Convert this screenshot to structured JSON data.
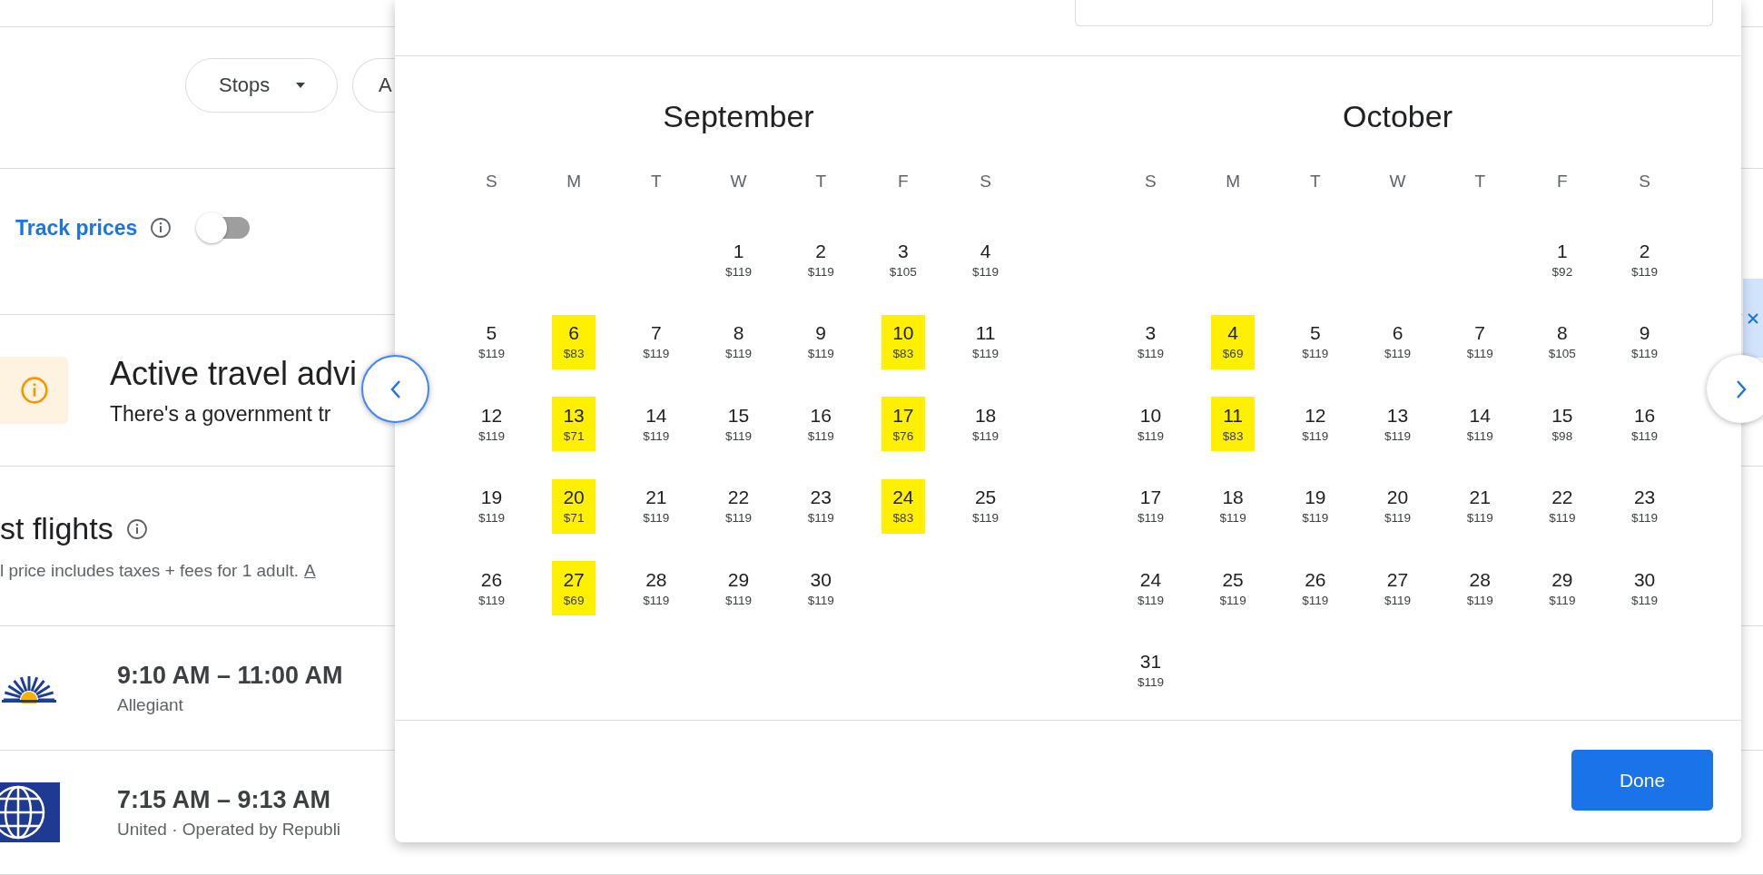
{
  "filters": [
    {
      "label": "Stops",
      "dropdown": true
    },
    {
      "label": "A"
    }
  ],
  "track_prices": {
    "label": "Track prices",
    "on": false
  },
  "advisory": {
    "title": "Active travel advi",
    "text": "There's a government tr"
  },
  "flights_section": {
    "title": "st flights",
    "note": "l price includes taxes + fees for 1 adult.",
    "link": "A"
  },
  "flights": [
    {
      "kind": "sun",
      "times": "9:10 AM – 11:00 AM",
      "airline": "Allegiant"
    },
    {
      "kind": "globe",
      "times": "7:15 AM – 9:13 AM",
      "airline": "United · Operated by Republi"
    }
  ],
  "calendar": {
    "months": [
      {
        "name": "September",
        "weekdays": [
          "S",
          "M",
          "T",
          "W",
          "T",
          "F",
          "S"
        ],
        "weeks": [
          [
            {
              "kind": "blank"
            },
            {
              "kind": "blank"
            },
            {
              "kind": "blank"
            },
            {
              "day": "1",
              "price": "$119",
              "highlighted": false
            },
            {
              "day": "2",
              "price": "$119",
              "highlighted": false
            },
            {
              "day": "3",
              "price": "$105",
              "highlighted": false
            },
            {
              "day": "4",
              "price": "$119",
              "highlighted": false
            }
          ],
          [
            {
              "day": "5",
              "price": "$119",
              "highlighted": false
            },
            {
              "day": "6",
              "price": "$83",
              "highlighted": true
            },
            {
              "day": "7",
              "price": "$119",
              "highlighted": false
            },
            {
              "day": "8",
              "price": "$119",
              "highlighted": false
            },
            {
              "day": "9",
              "price": "$119",
              "highlighted": false
            },
            {
              "day": "10",
              "price": "$83",
              "highlighted": true
            },
            {
              "day": "11",
              "price": "$119",
              "highlighted": false
            }
          ],
          [
            {
              "day": "12",
              "price": "$119",
              "highlighted": false
            },
            {
              "day": "13",
              "price": "$71",
              "highlighted": true
            },
            {
              "day": "14",
              "price": "$119",
              "highlighted": false
            },
            {
              "day": "15",
              "price": "$119",
              "highlighted": false
            },
            {
              "day": "16",
              "price": "$119",
              "highlighted": false
            },
            {
              "day": "17",
              "price": "$76",
              "highlighted": true
            },
            {
              "day": "18",
              "price": "$119",
              "highlighted": false
            }
          ],
          [
            {
              "day": "19",
              "price": "$119",
              "highlighted": false
            },
            {
              "day": "20",
              "price": "$71",
              "highlighted": true
            },
            {
              "day": "21",
              "price": "$119",
              "highlighted": false
            },
            {
              "day": "22",
              "price": "$119",
              "highlighted": false
            },
            {
              "day": "23",
              "price": "$119",
              "highlighted": false
            },
            {
              "day": "24",
              "price": "$83",
              "highlighted": true
            },
            {
              "day": "25",
              "price": "$119",
              "highlighted": false
            }
          ],
          [
            {
              "day": "26",
              "price": "$119",
              "highlighted": false
            },
            {
              "day": "27",
              "price": "$69",
              "highlighted": true
            },
            {
              "day": "28",
              "price": "$119",
              "highlighted": false
            },
            {
              "day": "29",
              "price": "$119",
              "highlighted": false
            },
            {
              "day": "30",
              "price": "$119",
              "highlighted": false
            }
          ]
        ]
      },
      {
        "name": "October",
        "weekdays": [
          "S",
          "M",
          "T",
          "W",
          "T",
          "F",
          "S"
        ],
        "weeks": [
          [
            {
              "kind": "blank"
            },
            {
              "kind": "blank"
            },
            {
              "kind": "blank"
            },
            {
              "kind": "blank"
            },
            {
              "kind": "blank"
            },
            {
              "day": "1",
              "price": "$92",
              "highlighted": false
            },
            {
              "day": "2",
              "price": "$119",
              "highlighted": false
            }
          ],
          [
            {
              "day": "3",
              "price": "$119",
              "highlighted": false
            },
            {
              "day": "4",
              "price": "$69",
              "highlighted": true
            },
            {
              "day": "5",
              "price": "$119",
              "highlighted": false
            },
            {
              "day": "6",
              "price": "$119",
              "highlighted": false
            },
            {
              "day": "7",
              "price": "$119",
              "highlighted": false
            },
            {
              "day": "8",
              "price": "$105",
              "highlighted": false
            },
            {
              "day": "9",
              "price": "$119",
              "highlighted": false
            }
          ],
          [
            {
              "day": "10",
              "price": "$119",
              "highlighted": false
            },
            {
              "day": "11",
              "price": "$83",
              "highlighted": true
            },
            {
              "day": "12",
              "price": "$119",
              "highlighted": false
            },
            {
              "day": "13",
              "price": "$119",
              "highlighted": false
            },
            {
              "day": "14",
              "price": "$119",
              "highlighted": false
            },
            {
              "day": "15",
              "price": "$98",
              "highlighted": false
            },
            {
              "day": "16",
              "price": "$119",
              "highlighted": false
            }
          ],
          [
            {
              "day": "17",
              "price": "$119",
              "highlighted": false
            },
            {
              "day": "18",
              "price": "$119",
              "highlighted": false
            },
            {
              "day": "19",
              "price": "$119",
              "highlighted": false
            },
            {
              "day": "20",
              "price": "$119",
              "highlighted": false
            },
            {
              "day": "21",
              "price": "$119",
              "highlighted": false
            },
            {
              "day": "22",
              "price": "$119",
              "highlighted": false
            },
            {
              "day": "23",
              "price": "$119",
              "highlighted": false
            }
          ],
          [
            {
              "day": "24",
              "price": "$119",
              "highlighted": false
            },
            {
              "day": "25",
              "price": "$119",
              "highlighted": false
            },
            {
              "day": "26",
              "price": "$119",
              "highlighted": false
            },
            {
              "day": "27",
              "price": "$119",
              "highlighted": false
            },
            {
              "day": "28",
              "price": "$119",
              "highlighted": false
            },
            {
              "day": "29",
              "price": "$119",
              "highlighted": false
            },
            {
              "day": "30",
              "price": "$119",
              "highlighted": false
            }
          ],
          [
            {
              "day": "31",
              "price": "$119",
              "highlighted": false
            }
          ]
        ]
      }
    ]
  },
  "done_button": "Done"
}
